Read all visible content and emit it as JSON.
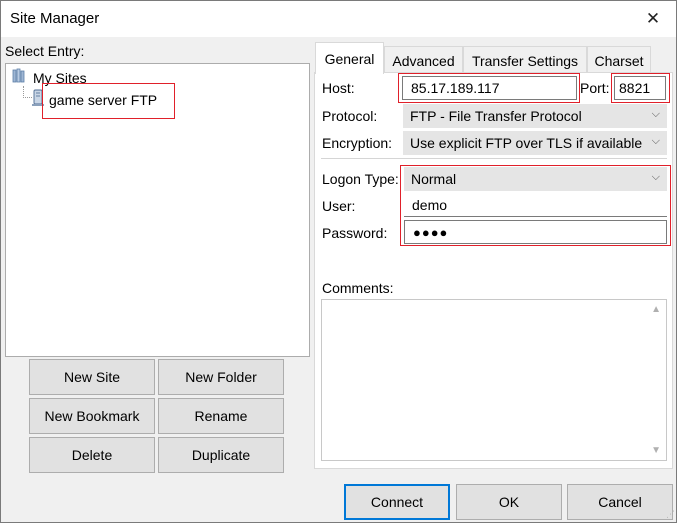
{
  "window": {
    "title": "Site Manager"
  },
  "left": {
    "select_entry_label": "Select Entry:",
    "tree": {
      "root": "My Sites",
      "child": "game server FTP"
    },
    "buttons": {
      "new_site": "New Site",
      "new_folder": "New Folder",
      "new_bookmark": "New Bookmark",
      "rename": "Rename",
      "delete": "Delete",
      "duplicate": "Duplicate"
    }
  },
  "tabs": [
    "General",
    "Advanced",
    "Transfer Settings",
    "Charset"
  ],
  "general": {
    "host_label": "Host:",
    "host_value": "85.17.189.117",
    "port_label": "Port:",
    "port_value": "8821",
    "protocol_label": "Protocol:",
    "protocol_value": "FTP - File Transfer Protocol",
    "encryption_label": "Encryption:",
    "encryption_value": "Use explicit FTP over TLS if available",
    "logon_type_label": "Logon Type:",
    "logon_type_value": "Normal",
    "user_label": "User:",
    "user_value": "demo",
    "password_label": "Password:",
    "password_value": "●●●●",
    "comments_label": "Comments:"
  },
  "bottom": {
    "connect": "Connect",
    "ok": "OK",
    "cancel": "Cancel"
  },
  "colors": {
    "highlight": "#e0202a",
    "default_button_border": "#0078d7"
  }
}
